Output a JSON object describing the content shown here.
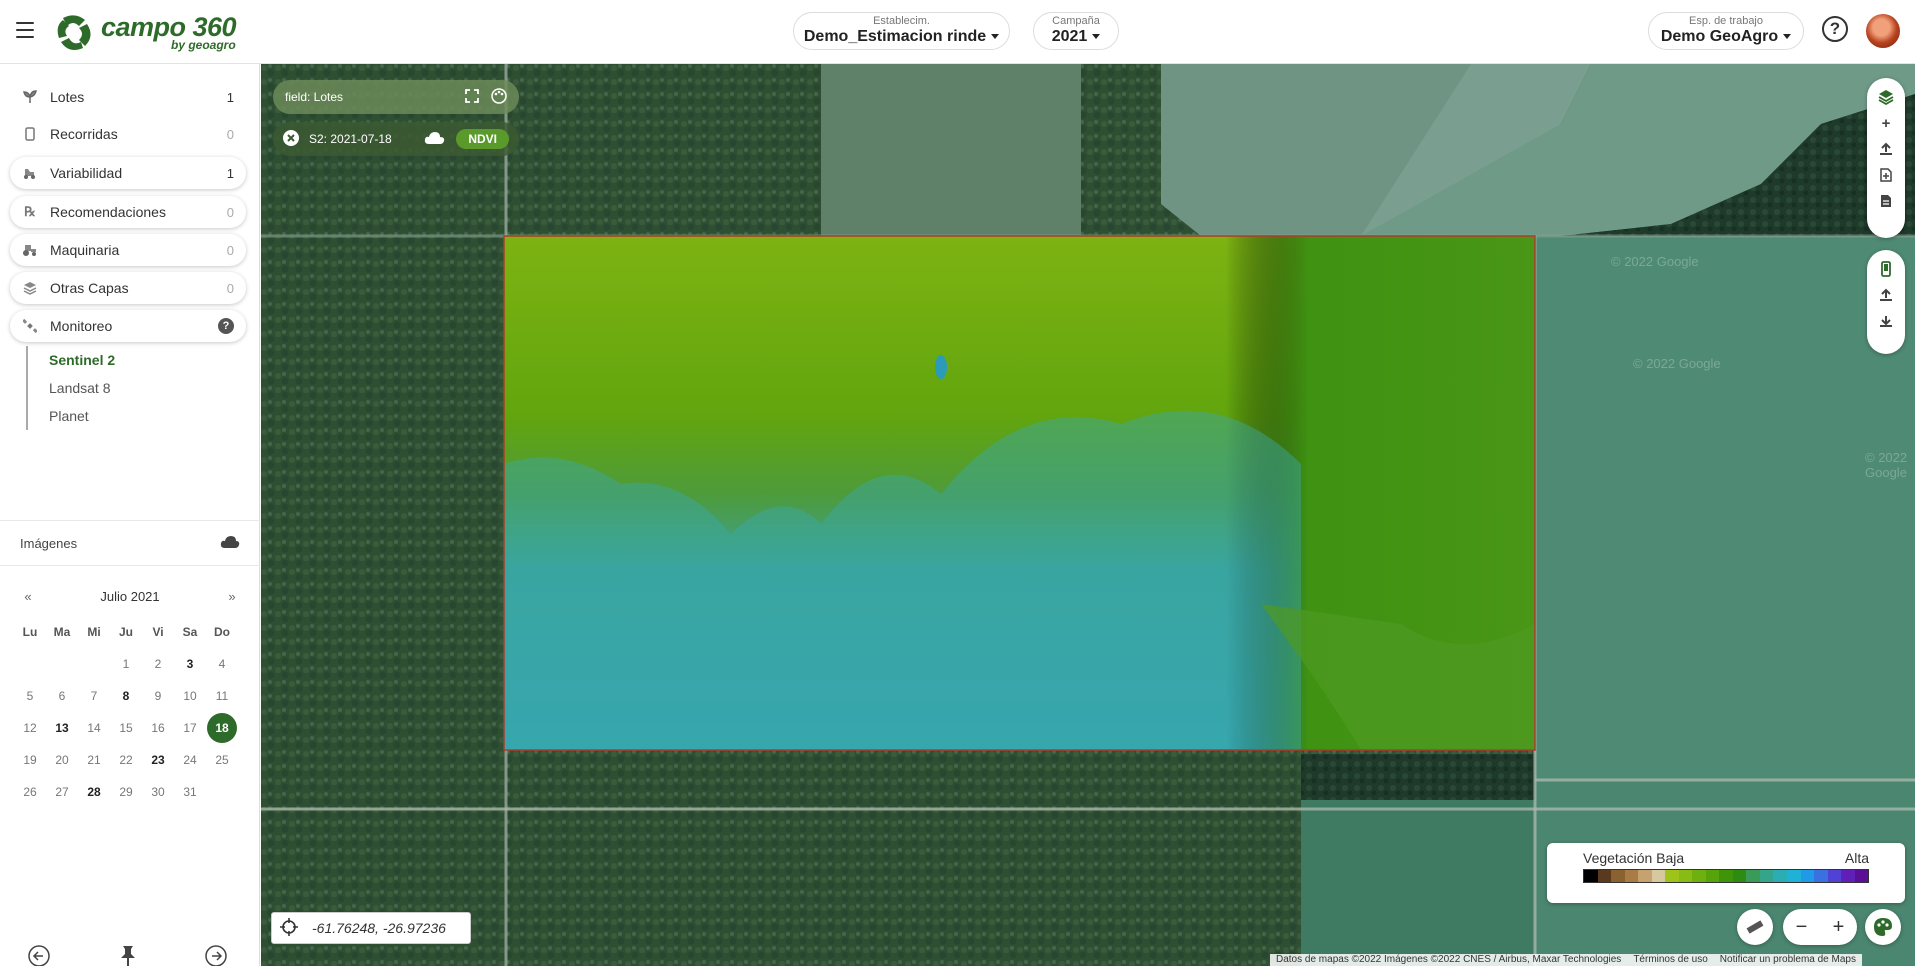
{
  "header": {
    "logo_text": "campo 360",
    "logo_sub": "by geoagro",
    "establecimiento": {
      "label": "Establecim.",
      "value": "Demo_Estimacion rinde"
    },
    "campana": {
      "label": "Campaña",
      "value": "2021"
    },
    "espacio": {
      "label": "Esp. de trabajo",
      "value": "Demo GeoAgro"
    },
    "help_label": "?"
  },
  "sidebar": {
    "items": [
      {
        "label": "Lotes",
        "count": "1",
        "icon": "sprout-icon"
      },
      {
        "label": "Recorridas",
        "count": "0",
        "icon": "phone-icon"
      },
      {
        "label": "Variabilidad",
        "count": "1",
        "icon": "tractor-icon"
      },
      {
        "label": "Recomendaciones",
        "count": "0",
        "icon": "prescription-icon"
      },
      {
        "label": "Maquinaria",
        "count": "0",
        "icon": "tractor-icon"
      },
      {
        "label": "Otras Capas",
        "count": "0",
        "icon": "layers-icon"
      },
      {
        "label": "Monitoreo",
        "count": "?",
        "icon": "satellite-icon"
      }
    ],
    "monitoreo_sub": [
      "Sentinel 2",
      "Landsat 8",
      "Planet"
    ],
    "imagenes_label": "Imágenes"
  },
  "calendar": {
    "prev": "«",
    "next": "»",
    "month": "Julio 2021",
    "days_of_week": [
      "Lu",
      "Ma",
      "Mi",
      "Ju",
      "Vi",
      "Sa",
      "Do"
    ],
    "weeks": [
      [
        "",
        "",
        "",
        "1",
        "2",
        "3",
        "4"
      ],
      [
        "5",
        "6",
        "7",
        "8",
        "9",
        "10",
        "11"
      ],
      [
        "12",
        "13",
        "14",
        "15",
        "16",
        "17",
        "18"
      ],
      [
        "19",
        "20",
        "21",
        "22",
        "23",
        "24",
        "25"
      ],
      [
        "26",
        "27",
        "28",
        "29",
        "30",
        "31",
        ""
      ]
    ],
    "image_dates": [
      "3",
      "8",
      "13",
      "23",
      "28"
    ],
    "selected": "18"
  },
  "map": {
    "layer_label": "field: Lotes",
    "image_label": "S2: 2021-07-18",
    "index_label": "NDVI",
    "coords": "-61.76248, -26.97236",
    "legend": {
      "low": "Vegetación Baja",
      "high": "Alta",
      "colors": [
        "#000000",
        "#5a3a1e",
        "#8a6232",
        "#a87c44",
        "#c6a270",
        "#d8c8a0",
        "#9fc419",
        "#88bb14",
        "#6fb00f",
        "#56a30b",
        "#3f9508",
        "#2d8a12",
        "#3a9a5a",
        "#34a58a",
        "#2aaeb4",
        "#20b2d6",
        "#1f9ae6",
        "#3a70e0",
        "#4f42d4",
        "#6020b8",
        "#5a0f96"
      ]
    },
    "zoom_out": "−",
    "zoom_in": "+",
    "watermark": "© 2022 Google",
    "attribution": [
      "Datos de mapas ©2022 Imágenes ©2022 CNES / Airbus, Maxar Technologies",
      "Términos de uso",
      "Notificar un problema de Maps"
    ]
  }
}
